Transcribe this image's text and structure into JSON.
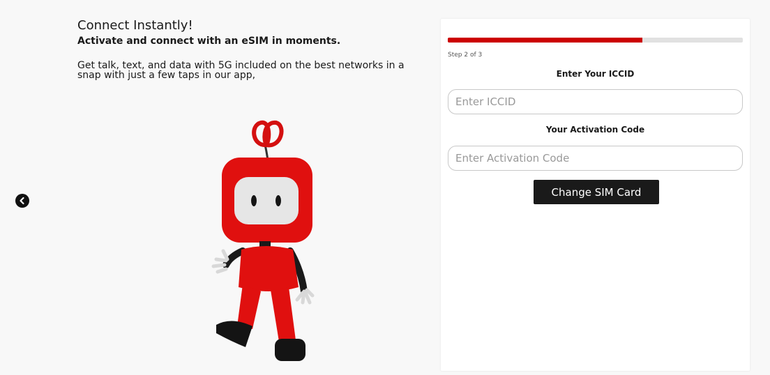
{
  "intro": {
    "headline": "Connect Instantly!",
    "subheadline": "Activate and connect with an eSIM in moments.",
    "body": "Get talk, text, and data with 5G included on the best networks in a snap with just a few taps in our app,"
  },
  "navigation": {
    "back_icon": "chevron-left-circle-icon"
  },
  "form": {
    "progress": 0.66,
    "step_text": "Step 2 of 3",
    "iccid_label": "Enter Your ICCID",
    "iccid_placeholder": "Enter ICCID",
    "iccid_value": "",
    "activation_label": "Your Activation Code",
    "activation_placeholder": "Enter Activation Code",
    "activation_value": "",
    "submit_label": "Change SIM Card"
  },
  "colors": {
    "accent": "#cc0000",
    "button": "#1a1a1a",
    "progress_track": "#e1e1e1",
    "background": "#f8f8f8"
  }
}
